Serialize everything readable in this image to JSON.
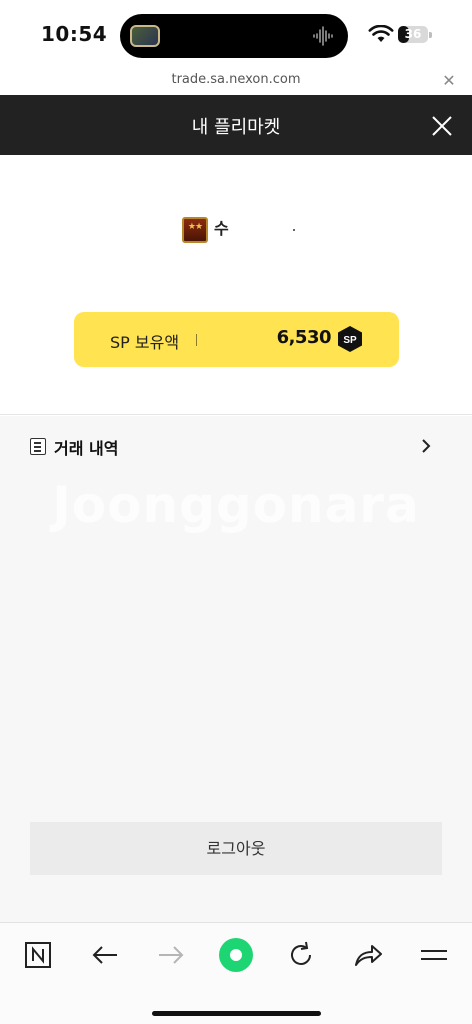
{
  "status_bar": {
    "time": "10:54",
    "battery": "36",
    "battery_level": 0.36
  },
  "browser": {
    "url": "trade.sa.nexon.com",
    "close_icon": "close-icon"
  },
  "header": {
    "title": "내 플리마켓",
    "close_icon": "close-x-icon"
  },
  "profile": {
    "nickname": "수",
    "rank_icon": "rank-badge-two-stars"
  },
  "sp": {
    "label": "SP 보유액",
    "amount": "6,530",
    "coin_label": "SP"
  },
  "menu": {
    "history_label": "거래 내역",
    "history_icon": "list-document-icon"
  },
  "watermark": "Joonggonara",
  "logout_label": "로그아웃",
  "toolbar": {
    "items": [
      "naver-n-icon",
      "back-arrow-icon",
      "forward-arrow-icon",
      "green-dot-icon",
      "refresh-icon",
      "share-icon",
      "menu-icon"
    ]
  },
  "colors": {
    "header_bg": "#222222",
    "sp_card": "#ffe350",
    "green": "#1ed573",
    "main_bg": "#f7f7f7"
  }
}
